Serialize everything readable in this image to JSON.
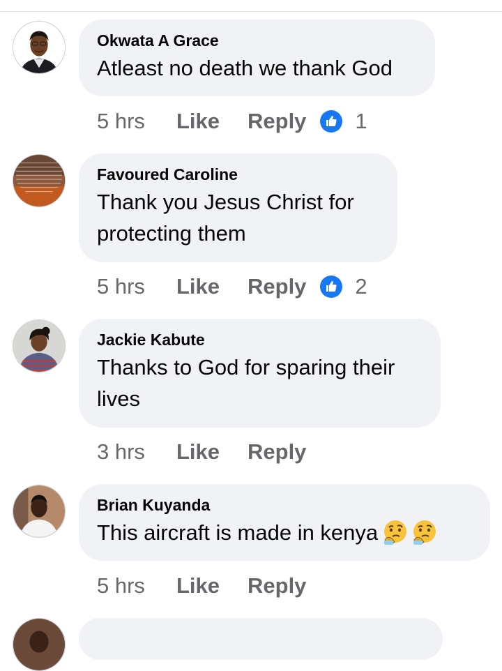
{
  "comments": [
    {
      "author": "Okwata A Grace",
      "lines": [
        "Atleast no death we thank God"
      ],
      "time": "5 hrs",
      "like_label": "Like",
      "reply_label": "Reply",
      "reaction_icon": "like-reaction-icon",
      "reaction_count": "1"
    },
    {
      "author": "Favoured Caroline",
      "lines": [
        "Thank you Jesus Christ for",
        "protecting them"
      ],
      "time": "5 hrs",
      "like_label": "Like",
      "reply_label": "Reply",
      "reaction_icon": "like-reaction-icon",
      "reaction_count": "2"
    },
    {
      "author": "Jackie Kabute",
      "lines": [
        "Thanks to God for sparing their",
        "lives"
      ],
      "time": "3 hrs",
      "like_label": "Like",
      "reply_label": "Reply"
    },
    {
      "author": "Brian Kuyanda",
      "lines": [
        "This aircraft is made in kenya"
      ],
      "emojis": [
        "thinking-face-emoji",
        "thinking-face-emoji"
      ],
      "time": "5 hrs",
      "like_label": "Like",
      "reply_label": "Reply"
    }
  ],
  "colors": {
    "bubble": "#f0f2f5",
    "secondary_text": "#65676b",
    "like_blue": "#1877f2"
  }
}
